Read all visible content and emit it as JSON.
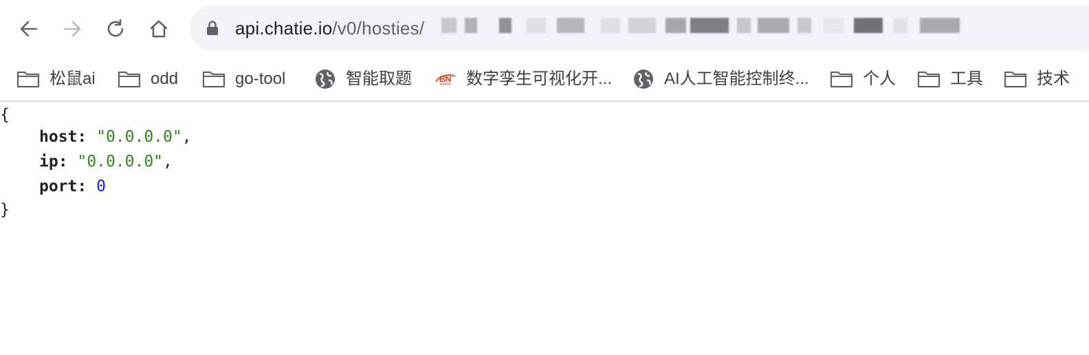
{
  "browser": {
    "url_host": "api.chatie.io",
    "url_path": "/v0/hosties/",
    "nav": {
      "back_icon": "arrow-left-icon",
      "forward_icon": "arrow-right-icon",
      "reload_icon": "reload-icon",
      "home_icon": "home-icon",
      "lock_icon": "lock-icon"
    }
  },
  "bookmarks": [
    {
      "label": "松鼠ai",
      "icon": "folder-icon"
    },
    {
      "label": "odd",
      "icon": "folder-icon"
    },
    {
      "label": "go-tool",
      "icon": "folder-icon"
    },
    {
      "label": "智能取题",
      "icon": "globe-icon"
    },
    {
      "label": "数字孪生可视化开...",
      "icon": "bn-logo-icon"
    },
    {
      "label": "AI人工智能控制终...",
      "icon": "globe-icon"
    },
    {
      "label": "个人",
      "icon": "folder-icon"
    },
    {
      "label": "工具",
      "icon": "folder-icon"
    },
    {
      "label": "技术",
      "icon": "folder-icon"
    }
  ],
  "json_view": {
    "open_brace": "{",
    "close_brace": "}",
    "entries": [
      {
        "key": "host",
        "value": "\"0.0.0.0\"",
        "type": "string",
        "suffix": ","
      },
      {
        "key": "ip",
        "value": "\"0.0.0.0\"",
        "type": "string",
        "suffix": ","
      },
      {
        "key": "port",
        "value": "0",
        "type": "number",
        "suffix": ""
      }
    ]
  },
  "colors": {
    "string": "#2b8a14",
    "number": "#1a1aff",
    "toolbar_pill": "#f1f3f4"
  }
}
